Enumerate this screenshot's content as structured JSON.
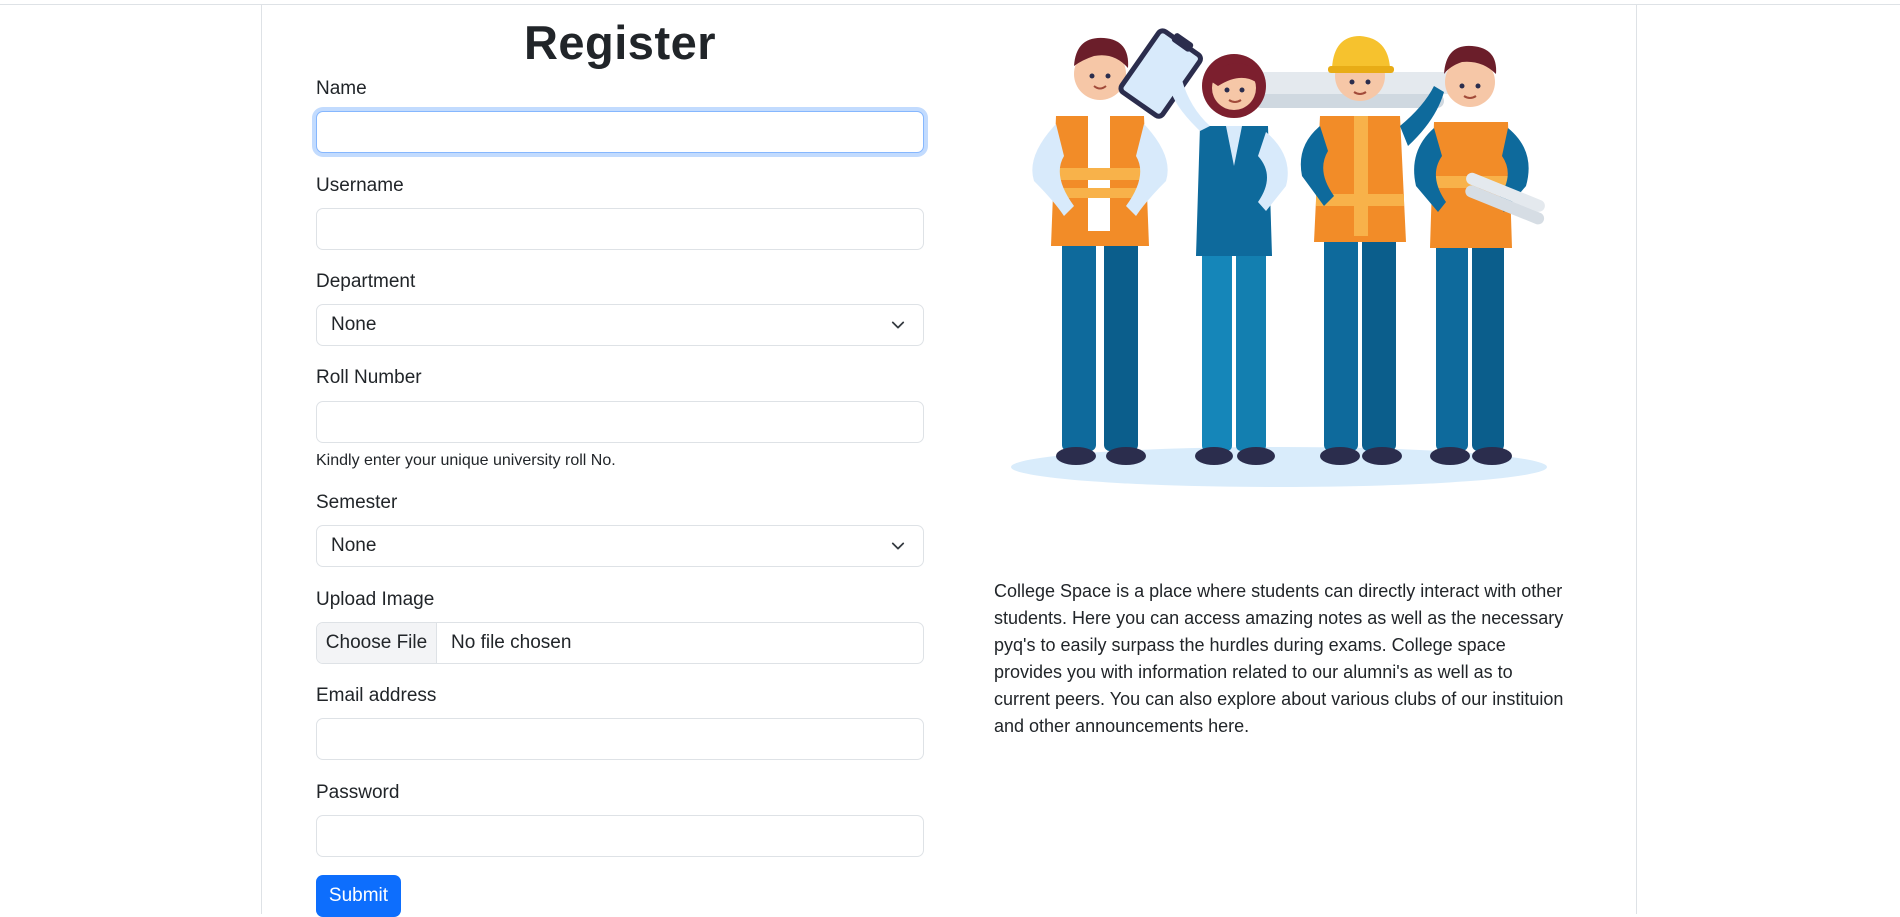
{
  "form": {
    "title": "Register",
    "name": {
      "label": "Name",
      "value": ""
    },
    "username": {
      "label": "Username",
      "value": ""
    },
    "department": {
      "label": "Department",
      "selected": "None"
    },
    "roll_number": {
      "label": "Roll Number",
      "value": "",
      "hint": "Kindly enter your unique university roll No."
    },
    "semester": {
      "label": "Semester",
      "selected": "None"
    },
    "upload_image": {
      "label": "Upload Image",
      "button": "Choose File",
      "status": "No file chosen"
    },
    "email": {
      "label": "Email address",
      "value": ""
    },
    "password": {
      "label": "Password",
      "value": ""
    },
    "submit_label": "Submit"
  },
  "about": {
    "description": "College Space is a place where students can directly interact with other students. Here you can access amazing notes as well as the necessary pyq's to easily surpass the hurdles during exams. College space provides you with information related to our alumni's as well as to current peers. You can also explore about various clubs of our instituion and other announcements here."
  },
  "colors": {
    "primary": "#0d6efd",
    "focus_border": "#86b7fe",
    "vest_orange": "#f28c28",
    "uniform_blue": "#0e6a9c"
  },
  "icons": [
    "chevron-down-icon",
    "chevron-down-icon"
  ]
}
